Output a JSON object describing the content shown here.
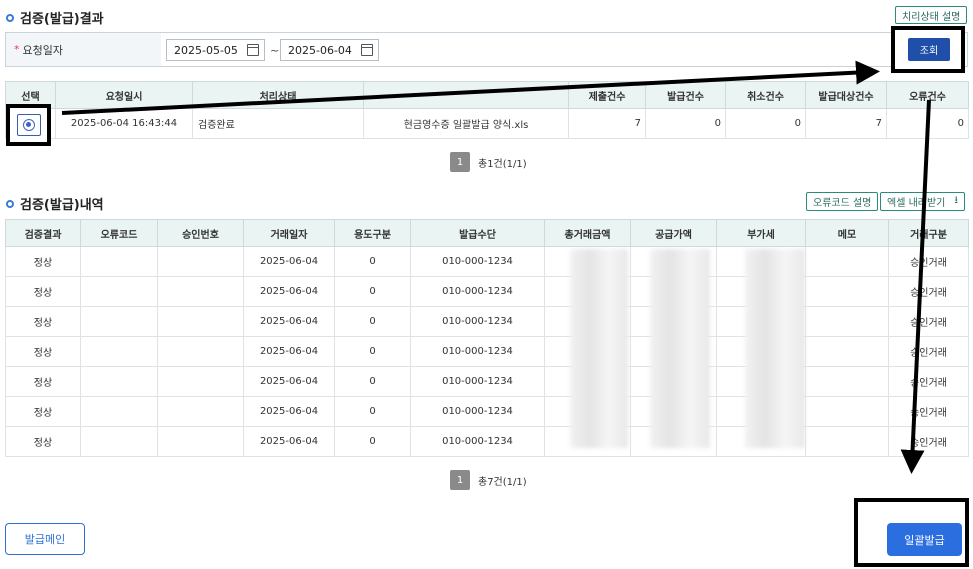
{
  "result_section": {
    "title": "검증(발급)결과",
    "status_help_label": "치리상태 설명"
  },
  "search": {
    "label": "요청일자",
    "required_mark": "*",
    "start_date": "2025-05-05",
    "end_date": "2025-06-04",
    "separator": "~",
    "submit_label": "조회"
  },
  "result_table": {
    "headers": [
      "선택",
      "요청일시",
      "처리상태",
      "",
      "제출건수",
      "발급건수",
      "취소건수",
      "발급대상건수",
      "오류건수"
    ],
    "rows": [
      {
        "requested_at": "2025-06-04 16:43:44",
        "status": "검증완료",
        "file_name": "현금영수증 일괄발급 양식.xls",
        "submitted": "7",
        "issued": "0",
        "canceled": "0",
        "target": "7",
        "errors": "0"
      }
    ],
    "pager": {
      "page": "1",
      "summary": "총1건(1/1)"
    }
  },
  "detail_section": {
    "title": "검증(발급)내역",
    "error_code_help_label": "오류코드 설명",
    "excel_download_label": "엑셀 내려받기"
  },
  "detail_table": {
    "headers": [
      "검증결과",
      "오류코드",
      "승인번호",
      "거래일자",
      "용도구분",
      "발급수단",
      "총거래금액",
      "공급가액",
      "부가세",
      "메모",
      "거래구분"
    ],
    "rows": [
      {
        "result": "정상",
        "error_code": "",
        "approval_no": "",
        "date": "2025-06-04",
        "usage": "0",
        "means": "010-000-1234",
        "memo": "",
        "type": "승인거래"
      },
      {
        "result": "정상",
        "error_code": "",
        "approval_no": "",
        "date": "2025-06-04",
        "usage": "0",
        "means": "010-000-1234",
        "memo": "",
        "type": "승인거래"
      },
      {
        "result": "정상",
        "error_code": "",
        "approval_no": "",
        "date": "2025-06-04",
        "usage": "0",
        "means": "010-000-1234",
        "memo": "",
        "type": "승인거래"
      },
      {
        "result": "정상",
        "error_code": "",
        "approval_no": "",
        "date": "2025-06-04",
        "usage": "0",
        "means": "010-000-1234",
        "memo": "",
        "type": "승인거래"
      },
      {
        "result": "정상",
        "error_code": "",
        "approval_no": "",
        "date": "2025-06-04",
        "usage": "0",
        "means": "010-000-1234",
        "memo": "",
        "type": "승인거래"
      },
      {
        "result": "정상",
        "error_code": "",
        "approval_no": "",
        "date": "2025-06-04",
        "usage": "0",
        "means": "010-000-1234",
        "memo": "",
        "type": "승인거래"
      },
      {
        "result": "정상",
        "error_code": "",
        "approval_no": "",
        "date": "2025-06-04",
        "usage": "0",
        "means": "010-000-1234",
        "memo": "",
        "type": "승인거래"
      }
    ],
    "pager": {
      "page": "1",
      "summary": "총7건(1/1)"
    }
  },
  "footer": {
    "issue_main_label": "발급메인",
    "batch_issue_label": "일괄발급"
  },
  "colors": {
    "primary": "#2a6ee0",
    "dark_primary": "#1f4fa8",
    "header_bg": "#e9f4f3",
    "teal_border": "#2a8a7c",
    "annotation": "#000000"
  },
  "icons": [
    "circle-bullet-icon",
    "calendar-icon",
    "radio-selected-icon",
    "download-icon",
    "arrow-annotation"
  ]
}
